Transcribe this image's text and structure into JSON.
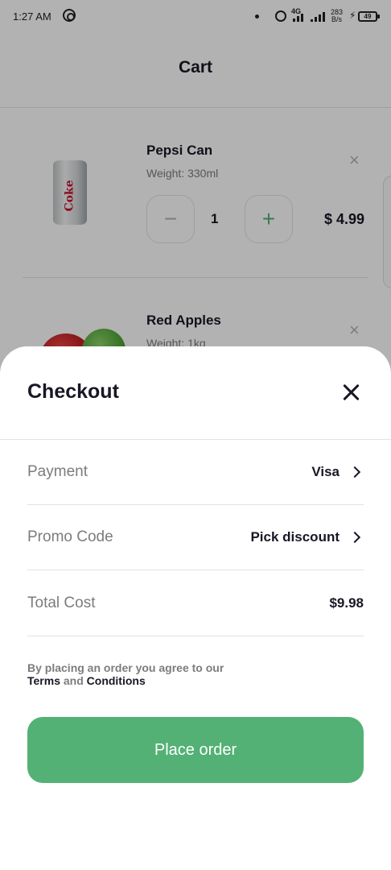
{
  "status_bar": {
    "time": "1:27 AM",
    "network_type": "4G",
    "speed_value": "283",
    "speed_unit": "B/s",
    "battery": "49"
  },
  "cart": {
    "title": "Cart",
    "items": [
      {
        "name": "Pepsi Can",
        "weight": "Weight: 330ml",
        "quantity": "1",
        "price": "$ 4.99",
        "image_icon": "soda-can-image",
        "can_text": "Coke"
      },
      {
        "name": "Red Apples",
        "weight": "Weight: 1kg",
        "image_icon": "apples-image"
      }
    ],
    "remove_icon": "×",
    "minus_icon": "−",
    "plus_icon": "+"
  },
  "checkout": {
    "title": "Checkout",
    "rows": [
      {
        "label": "Payment",
        "value": "Visa"
      },
      {
        "label": "Promo Code",
        "value": "Pick discount"
      },
      {
        "label": "Total Cost",
        "value": "$9.98"
      }
    ],
    "terms": {
      "prefix": "By placing an order you agree to our",
      "terms_link": "Terms",
      "and": "and",
      "conditions_link": "Conditions"
    },
    "place_order_label": "Place order"
  },
  "colors": {
    "accent": "#53b175",
    "text_primary": "#181725",
    "text_secondary": "#7c7c7c",
    "divider": "#e2e2e2"
  }
}
